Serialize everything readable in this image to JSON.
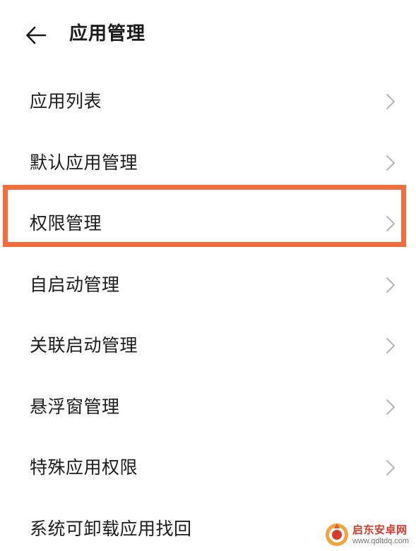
{
  "header": {
    "back_icon": "arrow-left-icon",
    "title": "应用管理"
  },
  "menu": {
    "chevron_icon": "chevron-right-icon",
    "items": [
      {
        "label": "应用列表"
      },
      {
        "label": "默认应用管理"
      },
      {
        "label": "权限管理"
      },
      {
        "label": "自启动管理"
      },
      {
        "label": "关联启动管理"
      },
      {
        "label": "悬浮窗管理"
      },
      {
        "label": "特殊应用权限"
      },
      {
        "label": "系统可卸载应用找回"
      }
    ]
  },
  "highlight": {
    "target": "权限管理",
    "color": "#f26d3d"
  },
  "watermark": {
    "title": "启东安卓网",
    "url": "www.qdltdq.com",
    "color": "#d63a2c"
  }
}
